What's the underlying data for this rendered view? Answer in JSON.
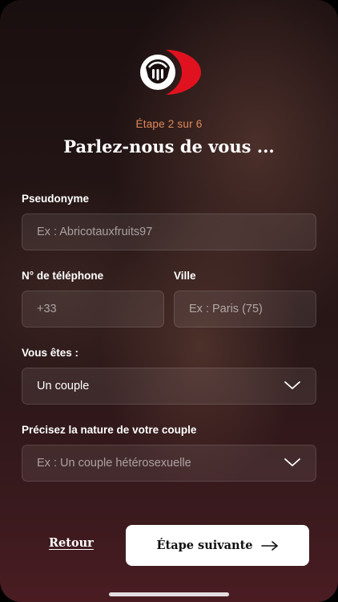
{
  "header": {
    "logo": "brand-logo-icon",
    "step_text": "Étape 2 sur 6",
    "title": "Parlez-nous de vous ..."
  },
  "form": {
    "pseudonyme": {
      "label": "Pseudonyme",
      "placeholder": "Ex : Abricotauxfruits97"
    },
    "telephone": {
      "label": "N° de téléphone",
      "placeholder": "+33"
    },
    "ville": {
      "label": "Ville",
      "placeholder": "Ex : Paris (75)"
    },
    "vous_etes": {
      "label": "Vous êtes :",
      "value": "Un couple"
    },
    "nature_couple": {
      "label": "Précisez la nature de votre couple",
      "placeholder": "Ex : Un couple hétérosexuelle"
    }
  },
  "footer": {
    "back_label": "Retour",
    "next_label": "Étape suivante"
  },
  "colors": {
    "accent_step": "#e0895a",
    "brand_red": "#e1121f",
    "button_bg": "#ffffff"
  }
}
